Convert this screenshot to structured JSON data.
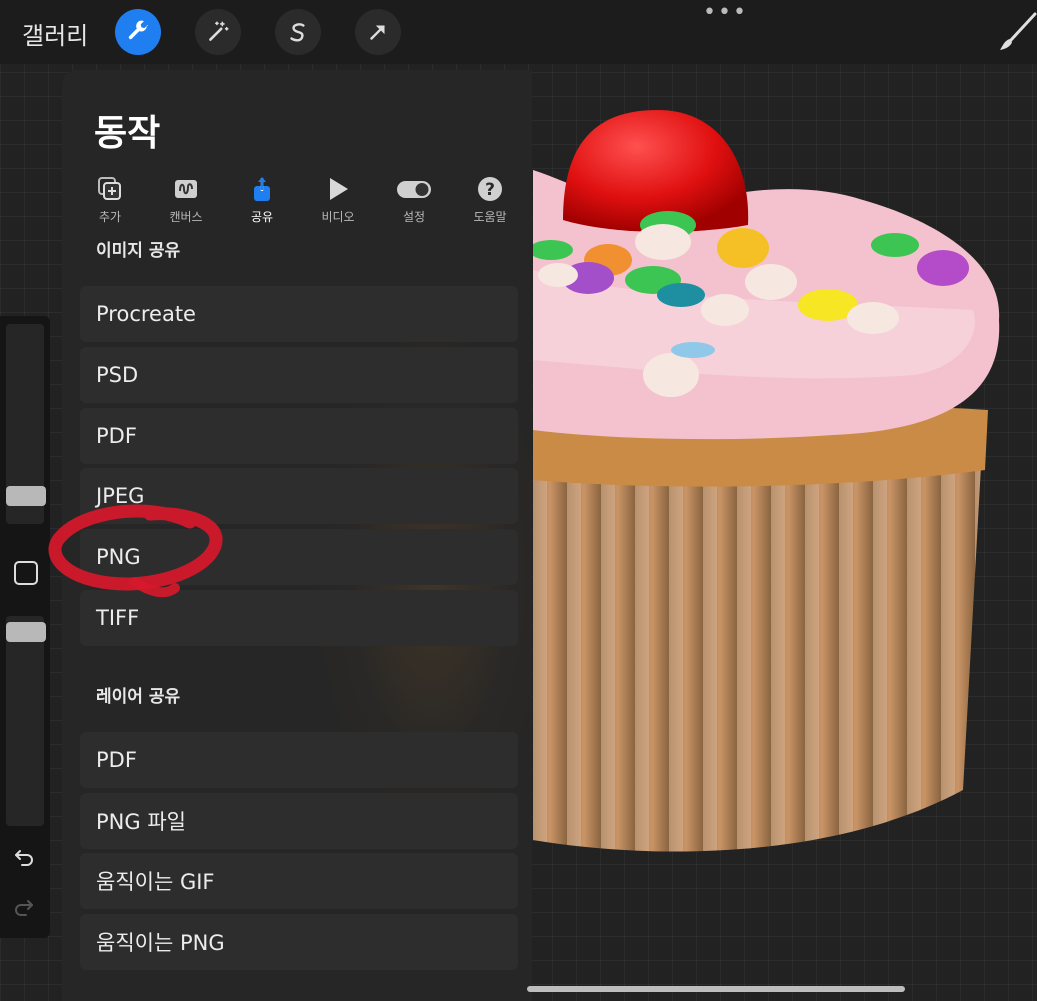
{
  "topbar": {
    "gallery_label": "갤러리",
    "more_dots": "•••",
    "tools": [
      {
        "name": "wrench-icon",
        "active": true
      },
      {
        "name": "magic-wand-icon",
        "active": false
      },
      {
        "name": "selection-icon",
        "active": false
      },
      {
        "name": "transform-arrow-icon",
        "active": false
      }
    ]
  },
  "panel": {
    "title": "동작",
    "tabs": [
      {
        "label": "추가",
        "icon": "add-icon"
      },
      {
        "label": "캔버스",
        "icon": "canvas-icon"
      },
      {
        "label": "공유",
        "icon": "share-icon",
        "active": true
      },
      {
        "label": "비디오",
        "icon": "play-icon"
      },
      {
        "label": "설정",
        "icon": "toggle-icon"
      },
      {
        "label": "도움말",
        "icon": "help-icon"
      }
    ],
    "image_share_title": "이미지 공유",
    "image_share_items": [
      "Procreate",
      "PSD",
      "PDF",
      "JPEG",
      "PNG",
      "TIFF"
    ],
    "layer_share_title": "레이어 공유",
    "layer_share_items": [
      "PDF",
      "PNG 파일",
      "움직이는 GIF",
      "움직이는 PNG"
    ]
  },
  "colors": {
    "accent": "#1f7ff0",
    "annotation": "#d8182a"
  }
}
